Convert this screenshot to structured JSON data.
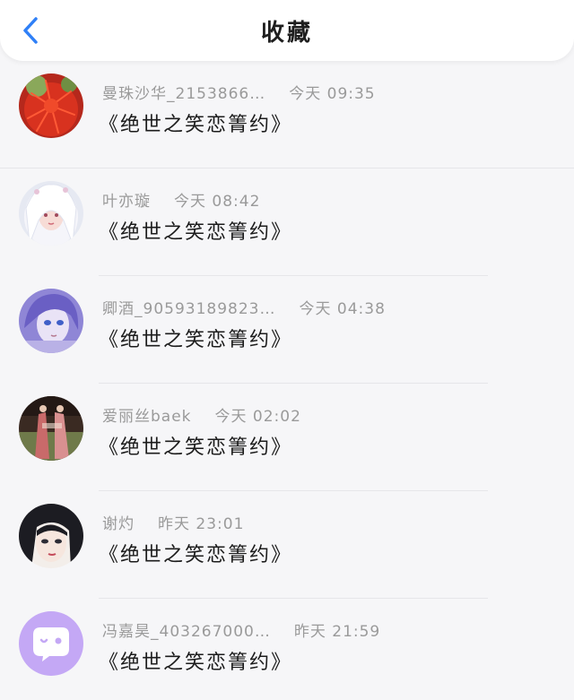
{
  "header": {
    "back_icon": "chevron-left-icon",
    "title": "收藏"
  },
  "colors": {
    "accent": "#2f80f7",
    "username": "#9a9a9a",
    "content": "#1c1c1c",
    "background": "#f6f6f8"
  },
  "items": [
    {
      "avatar": "red-flower-avatar",
      "name": "曼珠沙华_2153866…",
      "time": "今天 09:35",
      "content": "《绝世之笑恋箐约》"
    },
    {
      "avatar": "white-hair-girl-avatar",
      "name": "叶亦璇",
      "time": "今天 08:42",
      "content": "《绝世之笑恋箐约》"
    },
    {
      "avatar": "purple-anime-avatar",
      "name": "卿酒_90593189823…",
      "time": "今天 04:38",
      "content": "《绝世之笑恋箐约》"
    },
    {
      "avatar": "hanfu-photo-avatar",
      "name": "爱丽丝baek",
      "time": "今天 02:02",
      "content": "《绝世之笑恋箐约》"
    },
    {
      "avatar": "dark-hair-girl-avatar",
      "name": "谢灼",
      "time": "昨天 23:01",
      "content": "《绝世之笑恋箐约》"
    },
    {
      "avatar": "default-chat-avatar",
      "name": "冯嘉昊_403267000…",
      "time": "昨天 21:59",
      "content": "《绝世之笑恋箐约》"
    }
  ]
}
